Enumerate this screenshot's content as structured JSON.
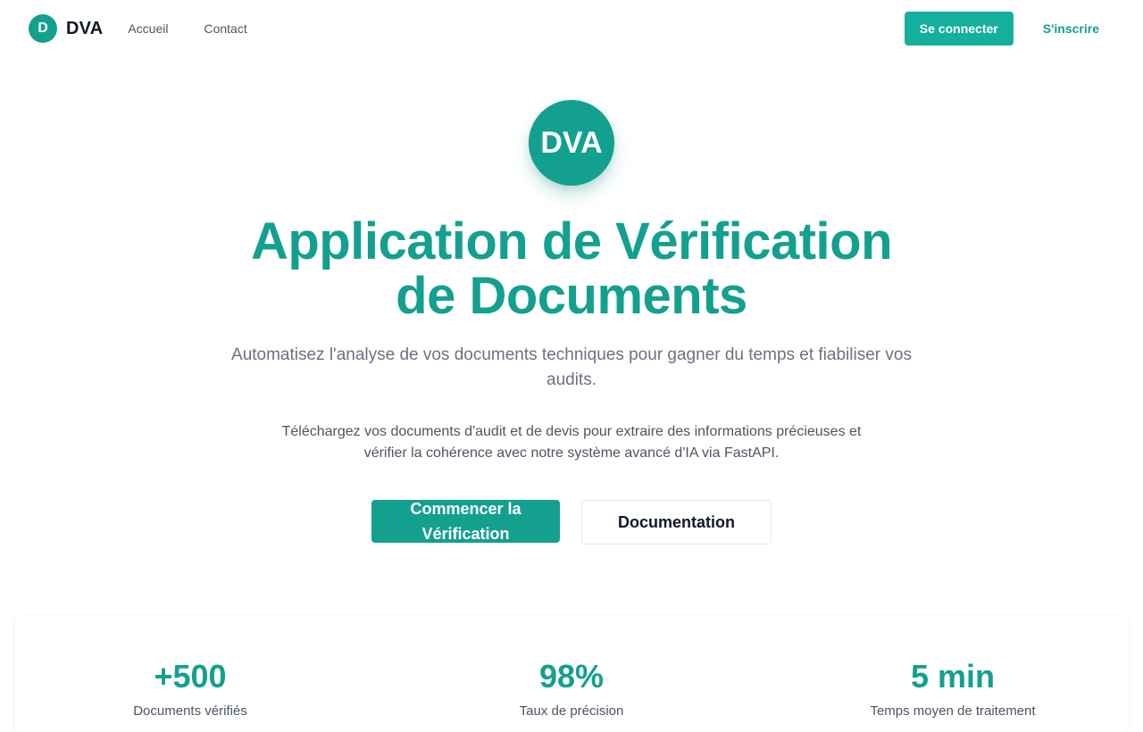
{
  "nav": {
    "brand_badge": "D",
    "brand_name": "DVA",
    "links": [
      "Accueil",
      "Contact"
    ],
    "login_label": "Se connecter",
    "signup_label": "S'inscrire"
  },
  "hero": {
    "logo_text": "DVA",
    "title": "Application de Vérification de Documents",
    "subtitle": "Automatisez l'analyse de vos documents techniques pour gagner du temps et fiabiliser vos audits.",
    "description": "Téléchargez vos documents d'audit et de devis pour extraire des informations précieuses et vérifier la cohérence avec notre système avancé d'IA via FastAPI.",
    "primary_button": "Commencer la Vérification",
    "secondary_button": "Documentation"
  },
  "stats": [
    {
      "value": "+500",
      "label": "Documents vérifiés"
    },
    {
      "value": "98%",
      "label": "Taux de précision"
    },
    {
      "value": "5 min",
      "label": "Temps moyen de traitement"
    }
  ],
  "colors": {
    "accent": "#14a08f",
    "accent_button": "#15b09d",
    "text_muted": "#6b7280"
  }
}
